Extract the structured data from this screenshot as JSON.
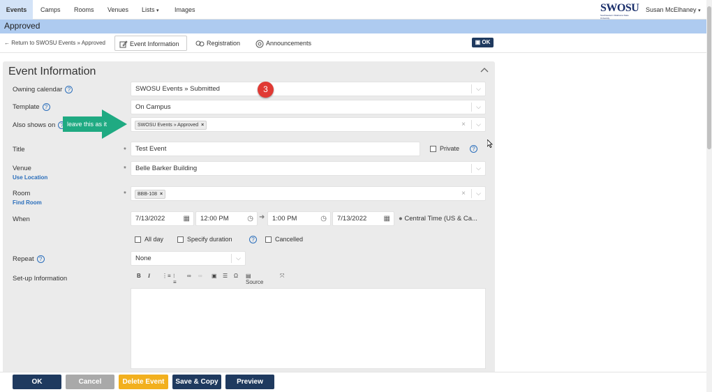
{
  "nav": {
    "items": [
      {
        "label": "Events"
      },
      {
        "label": "Camps"
      },
      {
        "label": "Rooms"
      },
      {
        "label": "Venues"
      },
      {
        "label": "Lists"
      },
      {
        "label": "Images"
      }
    ],
    "logo": "SWOSU",
    "logo_sub": "Southwestern Oklahoma State University",
    "user": "Susan McElhaney"
  },
  "banner": {
    "status": "Approved"
  },
  "toolbar": {
    "back": "Return to SWOSU Events » Approved",
    "tabs": [
      {
        "label": "Event Information"
      },
      {
        "label": "Registration"
      },
      {
        "label": "Announcements"
      }
    ],
    "ok": "OK"
  },
  "panel": {
    "title": "Event Information",
    "owning_calendar": {
      "label": "Owning calendar",
      "value": "SWOSU Events » Submitted"
    },
    "template": {
      "label": "Template",
      "value": "On Campus"
    },
    "also_shows_on": {
      "label": "Also shows on",
      "chip": "SWOSU Events » Approved"
    },
    "title_field": {
      "label": "Title",
      "value": "Test Event",
      "private_label": "Private"
    },
    "venue": {
      "label": "Venue",
      "link": "Use Location",
      "value": "Belle Barker Building"
    },
    "room": {
      "label": "Room",
      "link": "Find Room",
      "chip": "BBB-108"
    },
    "when": {
      "label": "When",
      "start_date": "7/13/2022",
      "start_time": "12:00 PM",
      "end_time": "1:00 PM",
      "end_date": "7/13/2022",
      "timezone": "Central Time (US & Ca...",
      "all_day": "All day",
      "specify_duration": "Specify duration",
      "cancelled": "Cancelled"
    },
    "repeat": {
      "label": "Repeat",
      "value": "None"
    },
    "setup": {
      "label": "Set-up Information",
      "source": "Source"
    }
  },
  "annotation": {
    "arrow_text": "leave this as it",
    "step": "3"
  },
  "buttons": {
    "ok": "OK",
    "cancel": "Cancel",
    "delete": "Delete Event",
    "save_copy": "Save & Copy",
    "preview": "Preview"
  },
  "colors": {
    "navy": "#1f3a5f",
    "banner": "#aecbf0",
    "delete": "#f2b01e",
    "cancel": "#a9a9a9",
    "arrow": "#1faa82",
    "badge": "#e03a34",
    "link": "#2a6ebb"
  }
}
